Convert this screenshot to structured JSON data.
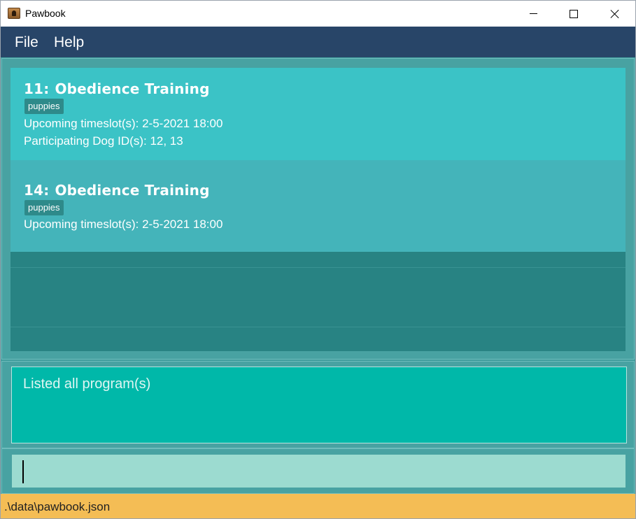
{
  "window": {
    "title": "Pawbook",
    "icon": "pawbook-app-icon"
  },
  "menu": {
    "items": [
      {
        "label": "File"
      },
      {
        "label": "Help"
      }
    ]
  },
  "programs": [
    {
      "index": "11:",
      "name": "Obedience Training",
      "tag": "puppies",
      "timeslots": "Upcoming timeslot(s): 2-5-2021 18:00",
      "dogs": "Participating Dog ID(s): 12, 13"
    },
    {
      "index": "14:",
      "name": "Obedience Training",
      "tag": "puppies",
      "timeslots": "Upcoming timeslot(s): 2-5-2021 18:00"
    }
  ],
  "result": {
    "text": "Listed all program(s)"
  },
  "command": {
    "value": ""
  },
  "status": {
    "file_path": ".\\data\\pawbook.json"
  },
  "colors": {
    "menubar": "#284568",
    "card_selected": "#3bc3c6",
    "card": "#44b4ba",
    "tag": "#2e8a8a",
    "result_bg": "#00b8a9",
    "command_bg": "#9cdbd0",
    "statusbar": "#f4bd55"
  }
}
